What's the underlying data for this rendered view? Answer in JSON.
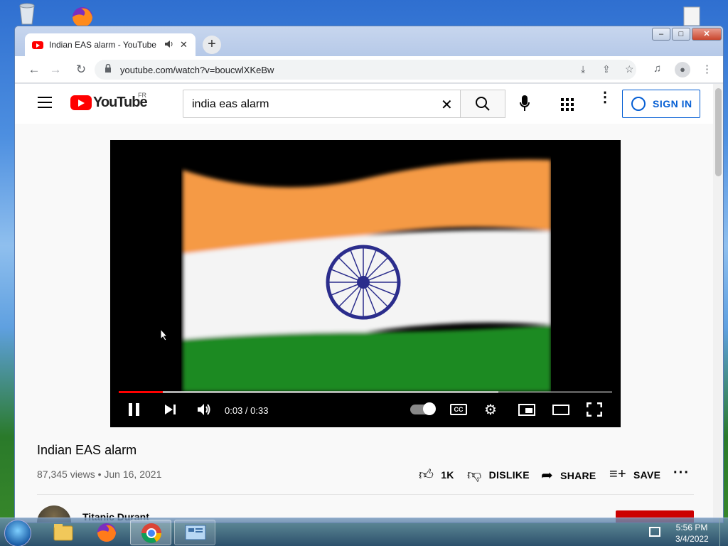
{
  "browser": {
    "tab_title": "Indian EAS alarm - YouTube",
    "tab_audio_icon": "speaker-icon",
    "tab_close": "✕",
    "new_tab": "+",
    "url": "youtube.com/watch?v=boucwlXKeBw"
  },
  "youtube": {
    "logo_text": "YouTube",
    "country_code": "FR",
    "search_value": "india eas alarm",
    "sign_in_label": "SIGN IN"
  },
  "player": {
    "time": "0:03 / 0:33",
    "progress_fraction": 0.09,
    "buffered_fraction": 0.77,
    "cc_label": "CC",
    "playing": true
  },
  "video": {
    "title": "Indian EAS alarm",
    "meta": "87,345 views • Jun 16, 2021",
    "likes": "1K",
    "dislike_label": "DISLIKE",
    "share_label": "SHARE",
    "save_label": "SAVE",
    "channel_name": "Titanic Durant"
  },
  "taskbar": {
    "time": "5:56 PM",
    "date": "3/4/2022"
  },
  "colors": {
    "yt_red": "#ff0000",
    "sign_in_blue": "#065fd4",
    "flag_saffron": "#f59a44",
    "flag_green": "#1f8a24",
    "chakra_navy": "#2b2d8c"
  }
}
